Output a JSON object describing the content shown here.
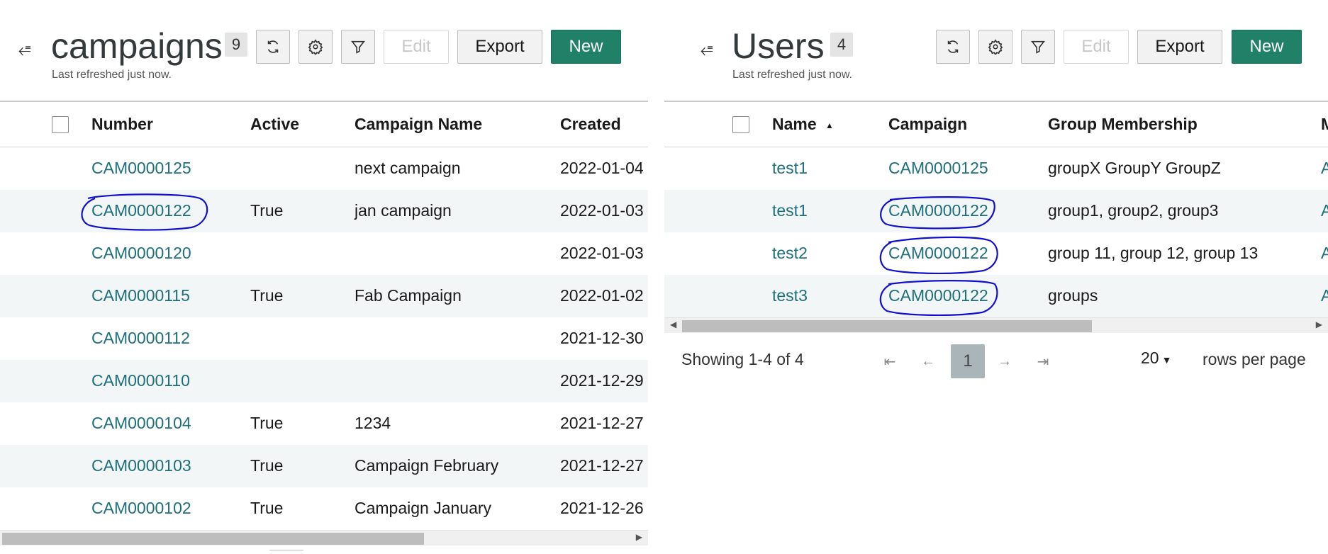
{
  "left": {
    "title": "campaigns",
    "count": "9",
    "subtitle": "Last refreshed just now.",
    "buttons": {
      "edit": "Edit",
      "export": "Export",
      "new": "New"
    },
    "columns": [
      "Number",
      "Active",
      "Campaign Name",
      "Created"
    ],
    "rows": [
      {
        "number": "CAM0000125",
        "active": "",
        "name": "next campaign",
        "created": "2022-01-04"
      },
      {
        "number": "CAM0000122",
        "active": "True",
        "name": "jan campaign",
        "created": "2022-01-03"
      },
      {
        "number": "CAM0000120",
        "active": "",
        "name": "",
        "created": "2022-01-03"
      },
      {
        "number": "CAM0000115",
        "active": "True",
        "name": "Fab Campaign",
        "created": "2022-01-02"
      },
      {
        "number": "CAM0000112",
        "active": "",
        "name": "",
        "created": "2021-12-30"
      },
      {
        "number": "CAM0000110",
        "active": "",
        "name": "",
        "created": "2021-12-29"
      },
      {
        "number": "CAM0000104",
        "active": "True",
        "name": "1234",
        "created": "2021-12-27"
      },
      {
        "number": "CAM0000103",
        "active": "True",
        "name": "Campaign February",
        "created": "2021-12-27"
      },
      {
        "number": "CAM0000102",
        "active": "True",
        "name": "Campaign January",
        "created": "2021-12-26"
      }
    ]
  },
  "right": {
    "title": "Users",
    "count": "4",
    "subtitle": "Last refreshed just now.",
    "buttons": {
      "edit": "Edit",
      "export": "Export",
      "new": "New"
    },
    "columns": [
      "Name",
      "Campaign",
      "Group Membership"
    ],
    "sort_indicator": "▲",
    "rows": [
      {
        "name": "test1",
        "campaign": "CAM0000125",
        "groups": "groupX GroupY GroupZ"
      },
      {
        "name": "test1",
        "campaign": "CAM0000122",
        "groups": "group1, group2, group3"
      },
      {
        "name": "test2",
        "campaign": "CAM0000122",
        "groups": "group 11, group 12, group 13"
      },
      {
        "name": "test3",
        "campaign": "CAM0000122",
        "groups": "groups"
      }
    ],
    "pager": {
      "showing": "Showing 1-4 of 4",
      "current_page": "1",
      "rows_per_page_value": "20",
      "rows_per_page_label": "rows per page"
    }
  },
  "icons": {
    "collapse": "collapse-menu-icon",
    "refresh": "refresh-icon",
    "settings": "gear-icon",
    "filter": "filter-icon",
    "first": "first-page-icon",
    "prev": "prev-page-icon",
    "next": "next-page-icon",
    "last": "last-page-icon"
  },
  "colors": {
    "primary": "#208068",
    "link": "#1d6f7c",
    "annotation": "#1010cc",
    "alt_row": "#f3f6f6"
  }
}
